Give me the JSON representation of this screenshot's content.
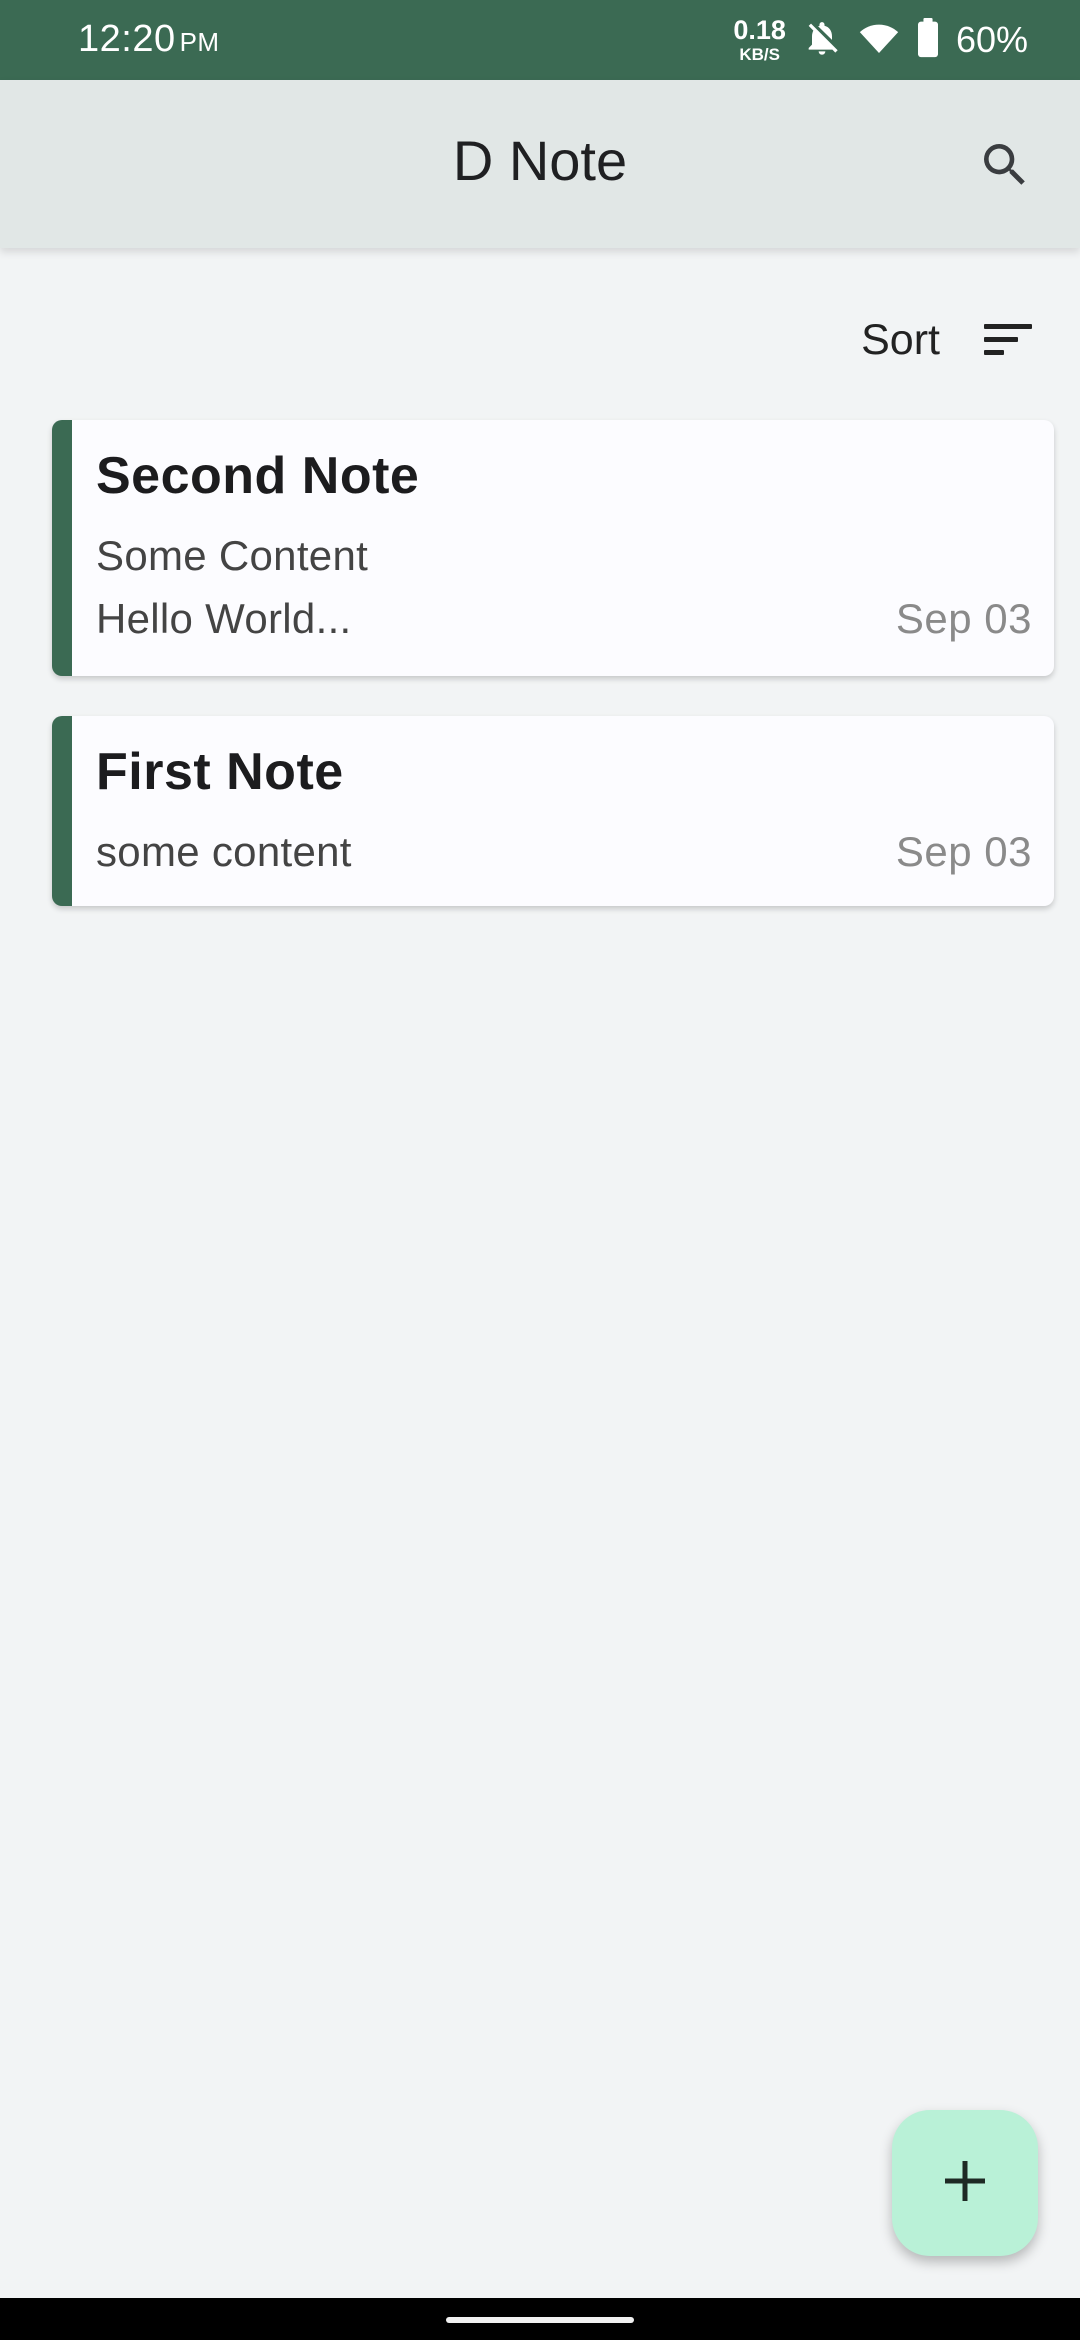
{
  "status_bar": {
    "time": "12:20",
    "ampm": "PM",
    "net_speed_value": "0.18",
    "net_speed_unit": "KB/S",
    "battery_percent": "60%",
    "icons": [
      "notifications-off-icon",
      "wifi-icon",
      "battery-icon"
    ]
  },
  "app_bar": {
    "title": "D Note",
    "search_icon": "search-icon"
  },
  "sort": {
    "label": "Sort",
    "icon": "sort-icon"
  },
  "notes": [
    {
      "title": "Second Note",
      "lines": [
        "Some Content",
        "Hello World..."
      ],
      "date": "Sep 03"
    },
    {
      "title": "First Note",
      "lines": [
        "some content"
      ],
      "date": "Sep 03"
    }
  ],
  "fab": {
    "icon": "add-icon"
  },
  "colors": {
    "status_bar": "#3b6a53",
    "app_bar": "#e1e7e6",
    "accent_stripe": "#3b6a53",
    "fab": "#b9f1d7",
    "background": "#f2f4f5"
  }
}
